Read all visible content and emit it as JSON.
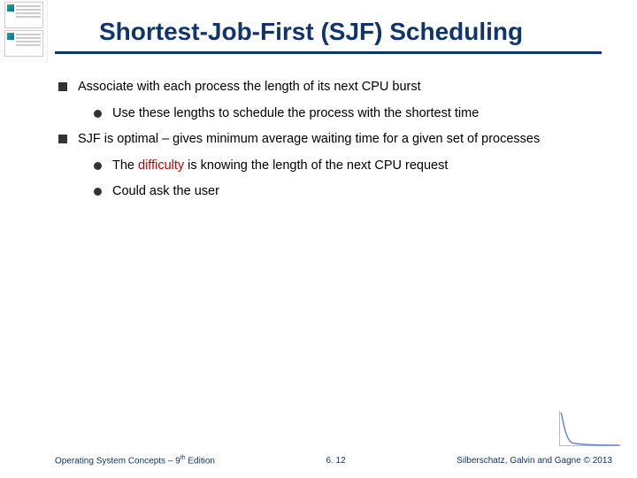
{
  "title": "Shortest-Job-First (SJF) Scheduling",
  "bullets": {
    "b1a": "Associate with each process the length of its next CPU burst",
    "b1a_sub1": "Use these lengths to schedule the process with the shortest time",
    "b1b": "SJF is optimal – gives minimum average waiting time for a given set of processes",
    "b1b_sub1_pre": "The ",
    "b1b_sub1_emph": "difficulty",
    "b1b_sub1_post": " is knowing the length of the next CPU request",
    "b1b_sub2": "Could ask the user"
  },
  "footer": {
    "left_pre": "Operating System Concepts – 9",
    "left_sup": "th",
    "left_post": " Edition",
    "center": "6. 12",
    "right": "Silberschatz, Galvin and Gagne © 2013"
  }
}
